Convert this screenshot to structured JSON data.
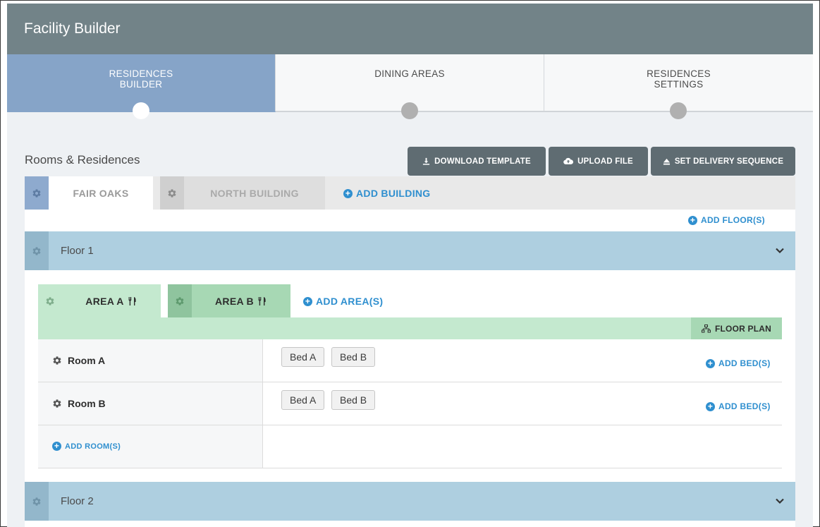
{
  "app": {
    "title": "Facility Builder"
  },
  "steps": [
    {
      "label": "RESIDENCES\nBUILDER",
      "active": true
    },
    {
      "label": "DINING AREAS",
      "active": false
    },
    {
      "label": "RESIDENCES\nSETTINGS",
      "active": false
    }
  ],
  "section": {
    "title": "Rooms & Residences"
  },
  "toolbar": {
    "download_label": "DOWNLOAD TEMPLATE",
    "upload_label": "UPLOAD FILE",
    "delivery_label": "SET DELIVERY SEQUENCE"
  },
  "buildings": [
    {
      "name": "FAIR OAKS",
      "active": true
    },
    {
      "name": "NORTH BUILDING",
      "active": false
    }
  ],
  "add_building_label": "ADD BUILDING",
  "add_floor_label": "ADD FLOOR(S)",
  "floors": [
    {
      "name": "Floor 1",
      "expanded": true
    },
    {
      "name": "Floor 2",
      "expanded": false
    }
  ],
  "areas": [
    {
      "name": "AREA A",
      "active": true
    },
    {
      "name": "AREA B",
      "active": false
    }
  ],
  "add_area_label": "ADD AREA(S)",
  "floor_plan_label": "FLOOR PLAN",
  "rooms": [
    {
      "name": "Room A",
      "beds": [
        "Bed A",
        "Bed B"
      ],
      "add_bed_label": "ADD BED(S)"
    },
    {
      "name": "Room B",
      "beds": [
        "Bed A",
        "Bed B"
      ],
      "add_bed_label": "ADD BED(S)"
    }
  ],
  "add_room_label": "ADD ROOM(S)",
  "icons": {
    "gear": "gear-icon",
    "download": "download-icon",
    "upload": "cloud-upload-icon",
    "delivery": "eject-icon",
    "plus": "plus-circle-icon",
    "utensils": "utensils-icon",
    "sitemap": "sitemap-icon",
    "chevron": "chevron-down-icon"
  },
  "colors": {
    "header": "#728388",
    "active_step": "#86a4c8",
    "floor_bar": "#aecfe0",
    "area_active": "#c4e9cf",
    "area_inactive": "#a7d8b4",
    "link": "#2f8fcf",
    "dark_button": "#5f6c72"
  }
}
